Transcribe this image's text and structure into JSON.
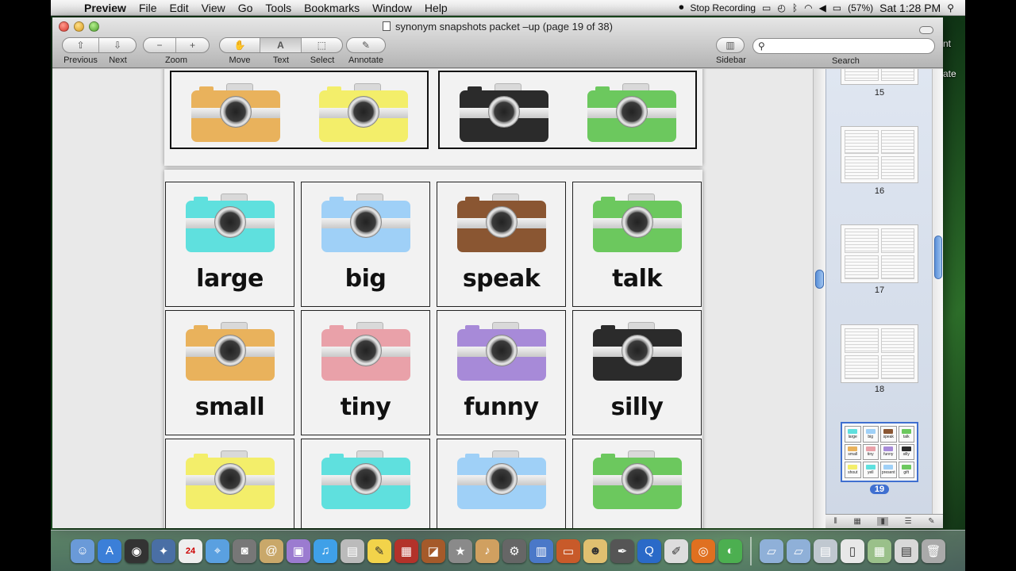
{
  "menubar": {
    "app_name": "Preview",
    "items": [
      "File",
      "Edit",
      "View",
      "Go",
      "Tools",
      "Bookmarks",
      "Window",
      "Help"
    ],
    "stop_recording": "Stop Recording",
    "battery": "(57%)",
    "clock": "Sat 1:28 PM"
  },
  "window": {
    "title": "synonym snapshots packet –up (page 19 of 38)"
  },
  "toolbar": {
    "previous_label": "Previous",
    "next_label": "Next",
    "zoom_label": "Zoom",
    "move_label": "Move",
    "text_label": "Text",
    "select_label": "Select",
    "annotate_label": "Annotate",
    "sidebar_label": "Sidebar",
    "search_label": "Search",
    "search_value": ""
  },
  "document": {
    "top_cameras": [
      {
        "color": "#e9b25c"
      },
      {
        "color": "#f3ee6a"
      },
      {
        "color": "#2b2b2b"
      },
      {
        "color": "#6cc85e"
      }
    ],
    "cards": [
      {
        "word": "large",
        "color": "#5fe0de"
      },
      {
        "word": "big",
        "color": "#9fd0f7"
      },
      {
        "word": "speak",
        "color": "#8a5632"
      },
      {
        "word": "talk",
        "color": "#6cc85e"
      },
      {
        "word": "small",
        "color": "#e9b25c"
      },
      {
        "word": "tiny",
        "color": "#e9a1a9"
      },
      {
        "word": "funny",
        "color": "#a78ad8"
      },
      {
        "word": "silly",
        "color": "#2b2b2b"
      },
      {
        "word": "",
        "color": "#f3ee6a"
      },
      {
        "word": "",
        "color": "#5fe0de"
      },
      {
        "word": "",
        "color": "#9fd0f7"
      },
      {
        "word": "",
        "color": "#6cc85e"
      }
    ]
  },
  "thumbnails": {
    "pages": [
      {
        "num": "15"
      },
      {
        "num": "16"
      },
      {
        "num": "17"
      },
      {
        "num": "18"
      },
      {
        "num": "19",
        "selected": true
      }
    ],
    "mini_words": [
      "large",
      "big",
      "speak",
      "talk",
      "small",
      "tiny",
      "funny",
      "silly",
      "shout",
      "yell",
      "present",
      "gift"
    ]
  },
  "desktop_labels": [
    "nt",
    "ate"
  ]
}
